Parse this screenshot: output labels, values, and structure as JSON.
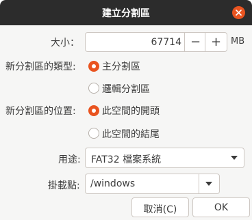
{
  "window": {
    "title": "建立分割區"
  },
  "size": {
    "label": "大小：",
    "value": "67714",
    "minus": "−",
    "plus": "+",
    "unit": "MB"
  },
  "type": {
    "label": "新分割區的類型:",
    "options": [
      {
        "label": "主分割區",
        "selected": true
      },
      {
        "label": "邏輯分割區",
        "selected": false
      }
    ]
  },
  "location": {
    "label": "新分割區的位置:",
    "options": [
      {
        "label": "此空間的開頭",
        "selected": true
      },
      {
        "label": "此空間的結尾",
        "selected": false
      }
    ]
  },
  "use_as": {
    "label": "用途:",
    "value": "FAT32 檔案系統"
  },
  "mount_point": {
    "label": "掛載點:",
    "value": "/windows"
  },
  "buttons": {
    "cancel": "取消(C)",
    "ok": "OK"
  },
  "colors": {
    "accent": "#e95420",
    "titlebar": "#2c2c2c",
    "background": "#f6f6f5"
  },
  "icons": {
    "close": "close-icon",
    "dropdown": "chevron-down-icon"
  }
}
